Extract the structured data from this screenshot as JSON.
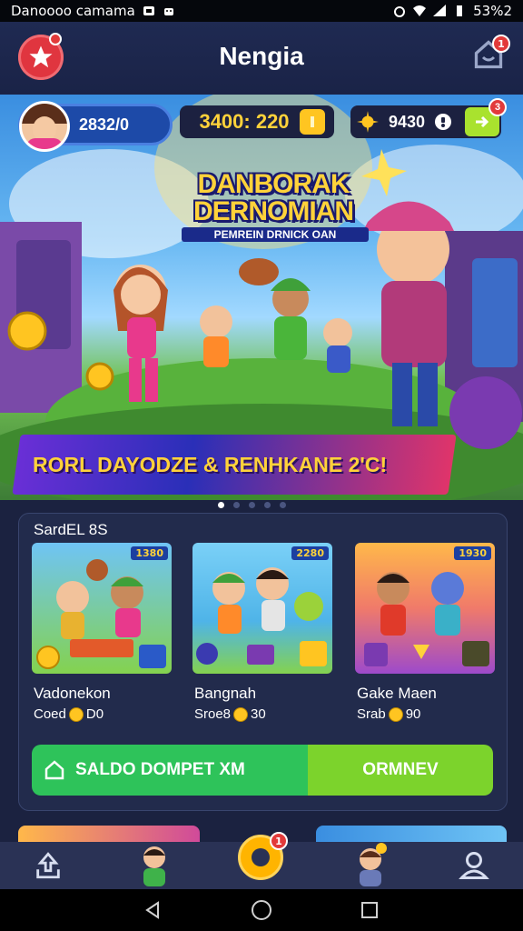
{
  "status_bar": {
    "left_text": "Danoooo camama",
    "right_text": "53%2"
  },
  "header": {
    "title": "Nengia",
    "notif_badge": "1"
  },
  "currency": {
    "player_value": "2832/0",
    "coins": "3400: 220",
    "gems": "9430",
    "gems_badge": "3"
  },
  "banner": {
    "title": "DANBORAK DERNOMIAN",
    "subtitle": "PEMREIN DRNICK OAN",
    "promo": "RORL DAYODZE & RENHKANE 2'C!",
    "slides": 5,
    "active_slide": 0
  },
  "section": {
    "title": "SardEL 8S",
    "cards": [
      {
        "name": "Vadonekon",
        "price_label": "Coed",
        "price": "D0",
        "badge": "1380"
      },
      {
        "name": "Bangnah",
        "price_label": "Sroe8",
        "price": "30",
        "badge": "2280"
      },
      {
        "name": "Gake Maen",
        "price_label": "Srab",
        "price": "90",
        "badge": "1930"
      }
    ],
    "wallet_button": "SALDO DOMPET XM",
    "wallet_action": "ORMNEV"
  },
  "bottom_nav": {
    "center_badge": "1"
  },
  "colors": {
    "background": "#1b2240",
    "accent_green": "#2ec35a",
    "accent_lime": "#7cd32c",
    "coin_yellow": "#ffc521",
    "logo_red": "#e0353f"
  }
}
